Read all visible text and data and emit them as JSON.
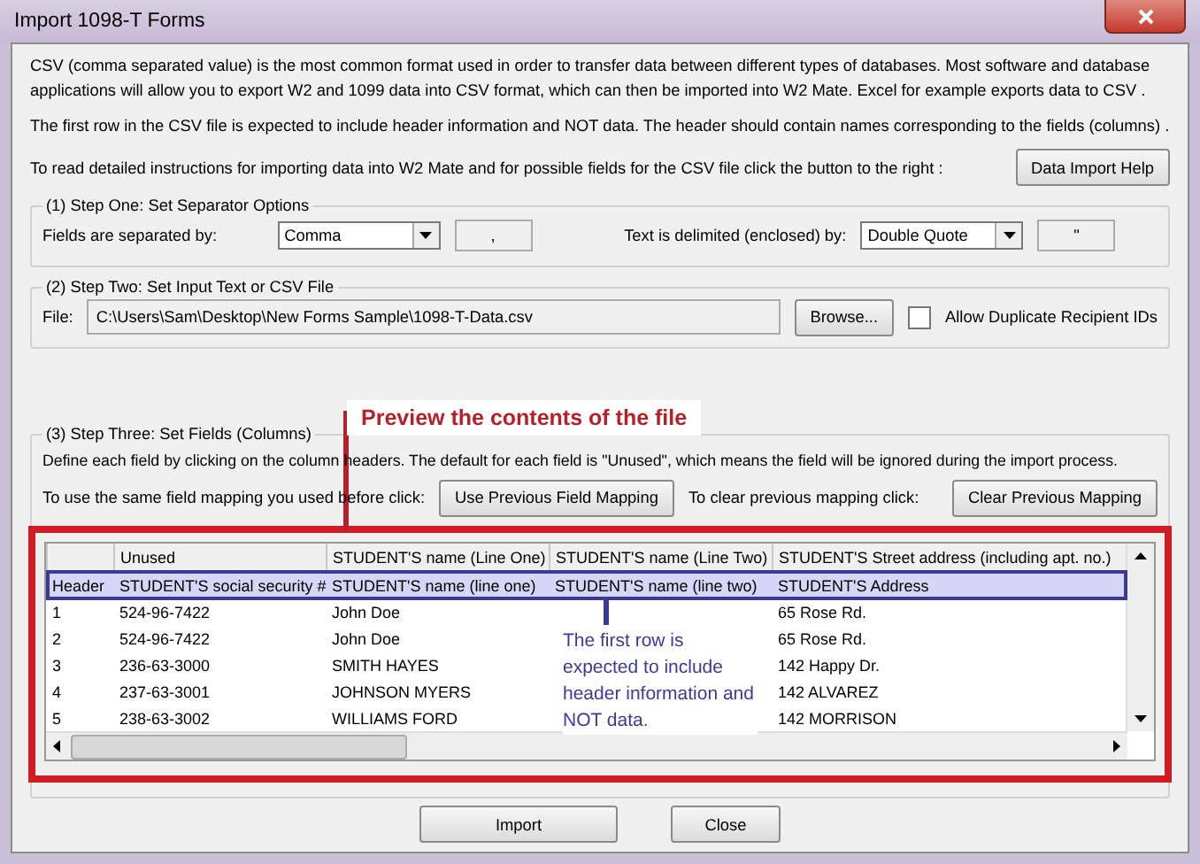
{
  "window": {
    "title": "Import 1098-T Forms"
  },
  "intro": [
    "CSV (comma separated value) is the most common format used in order to transfer data between different types of databases.  Most software and database applications will allow you to export W2 and 1099 data into CSV format, which can then be imported into W2 Mate. Excel for example exports data to CSV .",
    "The first row in the CSV file is expected to include header information and NOT data. The header should contain names corresponding to the fields (columns) ."
  ],
  "help": {
    "label": "To read detailed instructions for importing data into W2 Mate and for possible fields for the CSV file click the button to the right :",
    "button": "Data Import Help"
  },
  "step_one": {
    "title": "(1)  Step One: Set Separator Options",
    "fields_label": "Fields are separated by:",
    "fields_select": "Comma",
    "fields_char": ",",
    "text_label": "Text is delimited (enclosed) by:",
    "text_select": "Double Quote",
    "text_char": "\""
  },
  "step_two": {
    "title": "(2)  Step Two: Set Input Text or CSV File",
    "file_label": "File:",
    "file_value": "C:\\Users\\Sam\\Desktop\\New Forms Sample\\1098-T-Data.csv",
    "browse_button": "Browse...",
    "allow_duplicates": {
      "label": "Allow Duplicate Recipient IDs",
      "checked": false
    }
  },
  "step_three": {
    "title": "(3)  Step Three: Set Fields (Columns)",
    "description": "Define each field by clicking on the column headers. The default for each field is \"Unused\", which means the field will be ignored during the import process.",
    "reuse_label": "To use the same field mapping you used before click:",
    "reuse_button": "Use Previous Field Mapping",
    "clear_label": "To clear previous mapping click:",
    "clear_button": "Clear Previous Mapping",
    "grid": {
      "columns": [
        "Unused",
        "STUDENT'S name (Line One)",
        "STUDENT'S name (Line Two)",
        "STUDENT'S Street address (including apt. no.)"
      ],
      "rows": [
        {
          "row_header": "Header",
          "cells": [
            "STUDENT'S social security #",
            "STUDENT'S name (line one)",
            "STUDENT'S name (line two)",
            "STUDENT'S Address"
          ],
          "selected": true
        },
        {
          "row_header": "1",
          "cells": [
            "524-96-7422",
            "John Doe",
            "",
            "65 Rose Rd."
          ],
          "selected": false
        },
        {
          "row_header": "2",
          "cells": [
            "524-96-7422",
            "John Doe",
            "",
            "65 Rose Rd."
          ],
          "selected": false
        },
        {
          "row_header": "3",
          "cells": [
            "236-63-3000",
            "SMITH HAYES",
            "",
            "142 Happy Dr."
          ],
          "selected": false
        },
        {
          "row_header": "4",
          "cells": [
            "237-63-3001",
            "JOHNSON MYERS",
            "",
            "142 ALVAREZ"
          ],
          "selected": false
        },
        {
          "row_header": "5",
          "cells": [
            "238-63-3002",
            "WILLIAMS FORD",
            "",
            "142 MORRISON"
          ],
          "selected": false
        }
      ]
    }
  },
  "annotations": {
    "preview_callout": "Preview the contents of the file",
    "header_note": "The first row is expected to include header information and NOT data."
  },
  "buttons": [
    "Import",
    "Close"
  ]
}
